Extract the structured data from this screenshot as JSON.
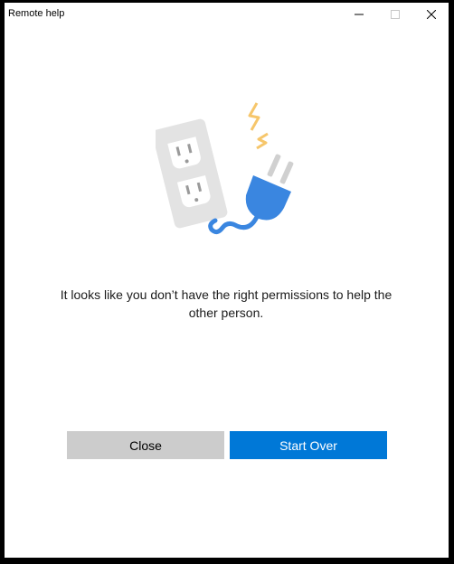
{
  "window": {
    "title": "Remote help"
  },
  "icons": {
    "minimize": "minimize-icon",
    "maximize": "maximize-icon",
    "close": "close-icon",
    "illustration": "unplugged-outlet-illustration"
  },
  "colors": {
    "accent": "#0078d7",
    "secondary_button": "#cccccc",
    "plug_blue": "#3a86e0",
    "spark_yellow": "#f6c66b",
    "outlet_gray": "#e3e3e3"
  },
  "main": {
    "message": "It looks like you don’t have the right permissions to help the other person."
  },
  "buttons": {
    "close_label": "Close",
    "start_over_label": "Start Over"
  }
}
